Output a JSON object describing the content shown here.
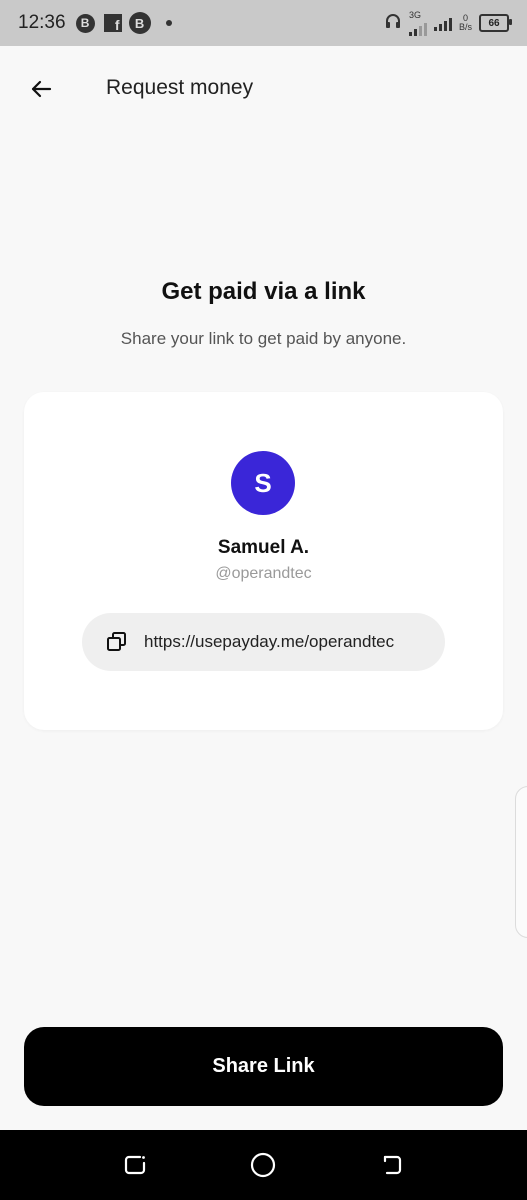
{
  "status_bar": {
    "time": "12:36",
    "badge_letter": "B",
    "fb_letter": "f",
    "network_type": "3G",
    "speed_value": "0",
    "speed_unit": "B/s",
    "battery_level": "66"
  },
  "header": {
    "title": "Request money",
    "back_icon": "arrow-left-icon"
  },
  "intro": {
    "title": "Get paid via a link",
    "subtitle": "Share your link to get paid by anyone."
  },
  "profile": {
    "avatar_letter": "S",
    "avatar_color": "#3a26d8",
    "name": "Samuel A.",
    "handle": "@operandtec",
    "link": "https://usepayday.me/operandtec",
    "copy_icon": "copy-icon"
  },
  "actions": {
    "share_label": "Share Link",
    "share_color": "#000000"
  },
  "nav": {
    "recents_icon": "recents-icon",
    "home_icon": "home-circle-icon",
    "back_icon": "nav-back-icon"
  }
}
